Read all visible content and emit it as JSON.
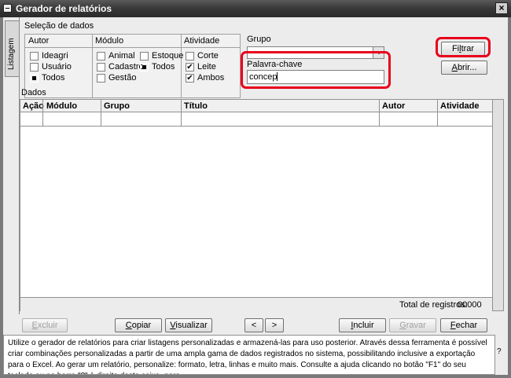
{
  "window": {
    "title": "Gerador de relatórios",
    "close_glyph": "×"
  },
  "sidetab": {
    "label": "Listagem"
  },
  "selection": {
    "section_title": "Seleção de dados",
    "autor": {
      "header": "Autor",
      "options": [
        {
          "label": "Ideagri",
          "state": "unchecked"
        },
        {
          "label": "Usuário",
          "state": "unchecked"
        },
        {
          "label": "Todos",
          "state": "selected"
        }
      ]
    },
    "modulo": {
      "header": "Módulo",
      "options": [
        {
          "label": "Animal",
          "state": "unchecked"
        },
        {
          "label": "Estoque",
          "state": "unchecked"
        },
        {
          "label": "Cadastro",
          "state": "unchecked"
        },
        {
          "label": "Todos",
          "state": "selected"
        },
        {
          "label": "Gestão",
          "state": "unchecked"
        }
      ]
    },
    "atividade": {
      "header": "Atividade",
      "options": [
        {
          "label": "Corte",
          "state": "unchecked"
        },
        {
          "label": "Leite",
          "state": "checked"
        },
        {
          "label": "Ambos",
          "state": "checked"
        }
      ]
    },
    "grupo": {
      "label": "Grupo",
      "value": ""
    },
    "palavra_chave": {
      "label": "Palavra-chave",
      "value": "concep"
    },
    "check_glyph": "✔"
  },
  "buttons": {
    "filtrar": {
      "prefix": "Fi",
      "u": "l",
      "suffix": "trar"
    },
    "abrir": {
      "u": "A",
      "suffix": "brir..."
    },
    "excluir": {
      "u": "E",
      "suffix": "xcluir"
    },
    "copiar": {
      "u": "C",
      "suffix": "opiar"
    },
    "visualizar": {
      "u": "V",
      "suffix": "isualizar"
    },
    "prev": "<",
    "next": ">",
    "incluir": {
      "u": "I",
      "suffix": "ncluir"
    },
    "gravar": {
      "u": "G",
      "suffix": "ravar"
    },
    "fechar": {
      "u": "F",
      "suffix": "echar"
    }
  },
  "grid": {
    "title": "Dados",
    "columns": [
      "Ação",
      "Módulo",
      "Grupo",
      "Título",
      "Autor",
      "Atividade"
    ],
    "total_label": "Total de registros:",
    "total_value": "00000"
  },
  "help": {
    "text": "Utilize o gerador de relatórios para criar listagens personalizadas e armazená-las para uso posterior. Através dessa ferramenta é possível criar combinações personalizadas a partir de uma ampla gama de dados registrados no sistema, possibilitando inclusive a exportação para o Excel. Ao gerar um relatório, personalize: formato, letra, linhas e muito mais. Consulte a ajuda clicando no botão \"F1\" do seu teclado ou na barra \"?\" à direita desta caixa, para",
    "question_mark": "?"
  },
  "colors": {
    "highlight": "#e8001c",
    "titlebar": "#3a3a3a"
  }
}
